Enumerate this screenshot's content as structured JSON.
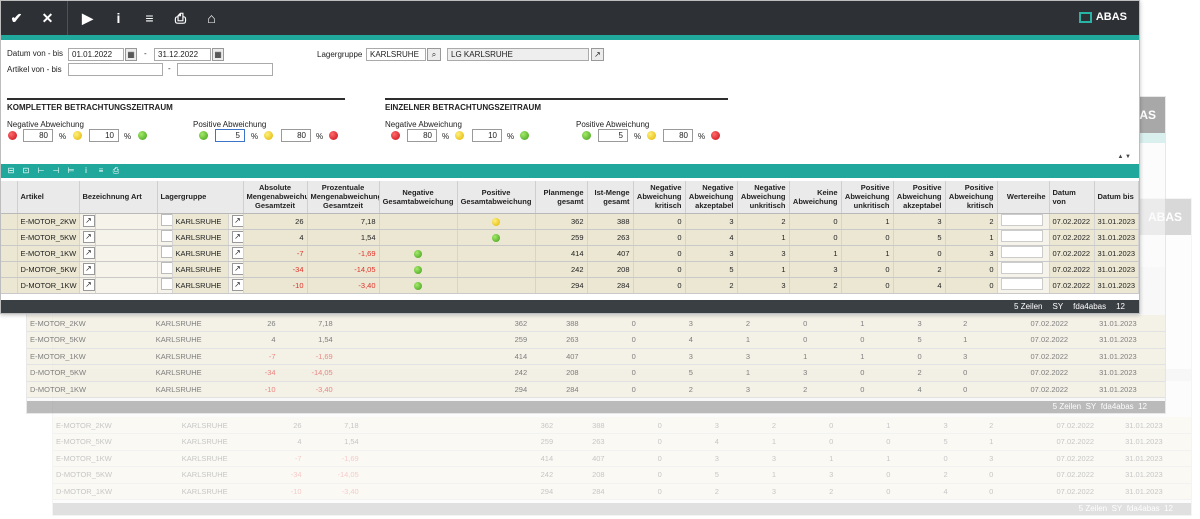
{
  "toolbar": {
    "items": [
      "check-icon",
      "close-icon",
      "play-icon",
      "info-icon",
      "menu-icon",
      "print-icon",
      "home-icon"
    ],
    "glyphs": [
      "✔",
      "✕",
      "▶",
      "i",
      "≡",
      "⎙",
      "⌂"
    ],
    "brand": "ABAS"
  },
  "form": {
    "datum_label": "Datum von - bis",
    "datum_from": "01.01.2022",
    "datum_to": "31.12.2022",
    "dash": "-",
    "artikel_label": "Artikel von - bis",
    "artikel_from": "",
    "artikel_to": "",
    "lagergruppe_label": "Lagergruppe",
    "lagergruppe_value": "KARLSRUHE",
    "lagergruppe_desc": "LG KARLSRUHE"
  },
  "section_total": {
    "title": "KOMPLETTER BETRACHTUNGSZEITRAUM",
    "neg_label": "Negative Abweichung",
    "neg_values": [
      "80",
      "10"
    ],
    "pos_label": "Positive Abweichung",
    "pos_values": [
      "5",
      "80"
    ],
    "pct": "%"
  },
  "section_single": {
    "title": "EINZELNER BETRACHTUNGSZEITRAUM",
    "neg_label": "Negative Abweichung",
    "neg_values": [
      "80",
      "10"
    ],
    "pos_label": "Positive Abweichung",
    "pos_values": [
      "5",
      "80"
    ],
    "pct": "%"
  },
  "colors": {
    "red": "#c40e18",
    "yellow": "#e0b400",
    "green": "#3f9e17",
    "accent": "#1fa89b",
    "toolbar": "#2d3136"
  },
  "table": {
    "headers": [
      "Artikel",
      "Bezeichnung Art",
      "Lagergruppe",
      "Absolute Mengenabweichung Gesamtzeit",
      "Prozentuale Mengenabweichung Gesamtzeit",
      "Negative Gesamtabweichung",
      "Positive Gesamtabweichung",
      "Planmenge gesamt",
      "Ist-Menge gesamt",
      "Negative Abweichung kritisch",
      "Negative Abweichung akzeptabel",
      "Negative Abweichung unkritisch",
      "Keine Abweichung",
      "Positive Abweichung unkritisch",
      "Positive Abweichung akzeptabel",
      "Positive Abweichung kritisch",
      "Wertereihe",
      "Datum von",
      "Datum bis"
    ],
    "rows": [
      {
        "artikel": "E-MOTOR_2KW",
        "lager": "KARLSRUHE",
        "abs": "26",
        "proz": "7,18",
        "negdot": "",
        "posdot": "yellow",
        "plan": "362",
        "ist": "388",
        "nk": "0",
        "na": "3",
        "nu": "2",
        "keine": "0",
        "pu": "1",
        "pa": "3",
        "pk": "2",
        "von": "07.02.2022",
        "bis": "31.01.2023"
      },
      {
        "artikel": "E-MOTOR_5KW",
        "lager": "KARLSRUHE",
        "abs": "4",
        "proz": "1,54",
        "negdot": "",
        "posdot": "green",
        "plan": "259",
        "ist": "263",
        "nk": "0",
        "na": "4",
        "nu": "1",
        "keine": "0",
        "pu": "0",
        "pa": "5",
        "pk": "1",
        "von": "07.02.2022",
        "bis": "31.01.2023"
      },
      {
        "artikel": "E-MOTOR_1KW",
        "lager": "KARLSRUHE",
        "abs": "-7",
        "proz": "-1,69",
        "negdot": "green",
        "posdot": "",
        "plan": "414",
        "ist": "407",
        "nk": "0",
        "na": "3",
        "nu": "3",
        "keine": "1",
        "pu": "1",
        "pa": "0",
        "pk": "3",
        "von": "07.02.2022",
        "bis": "31.01.2023"
      },
      {
        "artikel": "D-MOTOR_5KW",
        "lager": "KARLSRUHE",
        "abs": "-34",
        "proz": "-14,05",
        "negdot": "green",
        "posdot": "",
        "plan": "242",
        "ist": "208",
        "nk": "0",
        "na": "5",
        "nu": "1",
        "keine": "3",
        "pu": "0",
        "pa": "2",
        "pk": "0",
        "von": "07.02.2022",
        "bis": "31.01.2023"
      },
      {
        "artikel": "D-MOTOR_1KW",
        "lager": "KARLSRUHE",
        "abs": "-10",
        "proz": "-3,40",
        "negdot": "green",
        "posdot": "",
        "plan": "294",
        "ist": "284",
        "nk": "0",
        "na": "2",
        "nu": "3",
        "keine": "2",
        "pu": "0",
        "pa": "4",
        "pk": "0",
        "von": "07.02.2022",
        "bis": "31.01.2023"
      }
    ]
  },
  "status": {
    "rows": "5 Zeilen",
    "sy": "SY",
    "user": "fda4abas",
    "count": "12"
  }
}
